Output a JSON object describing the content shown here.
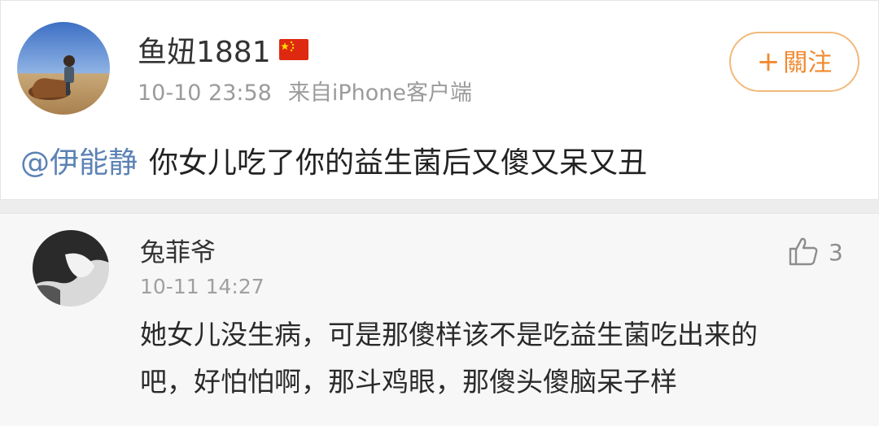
{
  "post": {
    "username": "鱼妞1881",
    "flag_icon": "china-flag-icon",
    "timestamp": "10-10 23:58",
    "source": "来自iPhone客户端",
    "follow_plus": "+",
    "follow_label": "關注",
    "mention": "@伊能静",
    "text": "你女儿吃了你的益生菌后又傻又呆又丑"
  },
  "comment": {
    "username": "兔菲爷",
    "timestamp": "10-11 14:27",
    "like_icon": "thumbs-up-icon",
    "like_count": "3",
    "text_line1": "她女儿没生病，可是那傻样该不是吃益生菌吃出来的",
    "text_line2": "吧，好怕怕啊，那斗鸡眼，那傻头傻脑呆子样"
  },
  "colors": {
    "accent_follow": "#f08a2f",
    "mention": "#5b82b4"
  }
}
